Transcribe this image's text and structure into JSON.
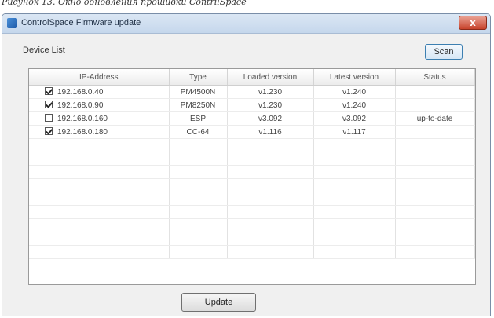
{
  "caption": "Рисунок 13. Окно обновления прошивки ContrilSpace",
  "window": {
    "title": "ControlSpace Firmware update",
    "close_glyph": "x"
  },
  "device_list_label": "Device List",
  "scan_label": "Scan",
  "update_label": "Update",
  "table": {
    "columns": [
      "IP-Address",
      "Type",
      "Loaded version",
      "Latest version",
      "Status"
    ],
    "rows": [
      {
        "checked": true,
        "ip": "192.168.0.40",
        "type": "PM4500N",
        "loaded": "v1.230",
        "latest": "v1.240",
        "status": ""
      },
      {
        "checked": true,
        "ip": "192.168.0.90",
        "type": "PM8250N",
        "loaded": "v1.230",
        "latest": "v1.240",
        "status": ""
      },
      {
        "checked": false,
        "ip": "192.168.0.160",
        "type": "ESP",
        "loaded": "v3.092",
        "latest": "v3.092",
        "status": "up-to-date"
      },
      {
        "checked": true,
        "ip": "192.168.0.180",
        "type": "CC-64",
        "loaded": "v1.116",
        "latest": "v1.117",
        "status": ""
      }
    ],
    "empty_rows": 9
  }
}
